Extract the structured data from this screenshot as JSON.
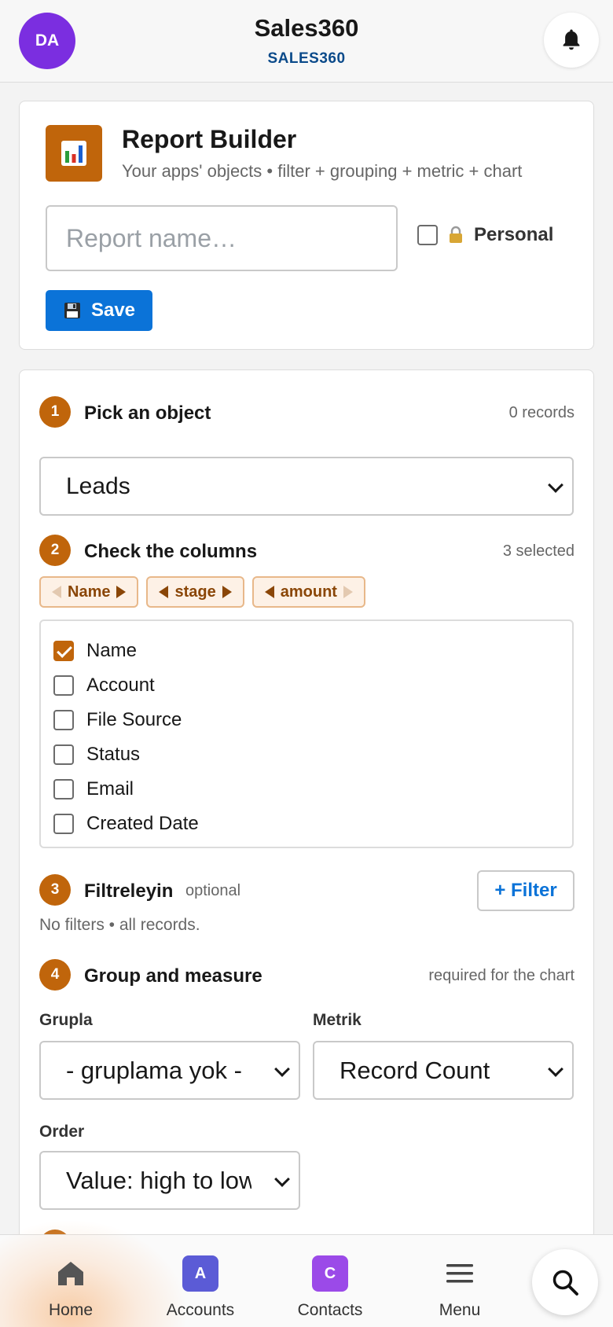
{
  "header": {
    "avatar_initials": "DA",
    "title": "Sales360",
    "subtitle": "SALES360"
  },
  "report": {
    "title": "Report Builder",
    "subtitle": "Your apps' objects • filter + grouping + metric + chart",
    "name_placeholder": "Report name…",
    "name_value": "",
    "personal_label": "Personal",
    "personal_checked": false,
    "save_label": "Save"
  },
  "step1": {
    "number": "1",
    "title": "Pick an object",
    "meta": "0 records",
    "selected_object": "Leads"
  },
  "step2": {
    "number": "2",
    "title": "Check the columns",
    "meta": "3 selected",
    "chips": [
      "Name",
      "stage",
      "amount"
    ],
    "columns": [
      {
        "label": "Name",
        "checked": true
      },
      {
        "label": "Account",
        "checked": false
      },
      {
        "label": "File Source",
        "checked": false
      },
      {
        "label": "Status",
        "checked": false
      },
      {
        "label": "Email",
        "checked": false
      },
      {
        "label": "Created Date",
        "checked": false
      }
    ]
  },
  "step3": {
    "number": "3",
    "title": "Filtreleyin",
    "meta": "optional",
    "add_filter_label": "+ Filter",
    "empty_text": "No filters • all records."
  },
  "step4": {
    "number": "4",
    "title": "Group and measure",
    "meta": "required for the chart",
    "group_label": "Grupla",
    "group_value": "- gruplama yok -",
    "metric_label": "Metrik",
    "metric_value": "Record Count",
    "order_label": "Order",
    "order_value": "Value: high to low"
  },
  "bottom_nav": {
    "items": [
      {
        "label": "Home",
        "icon": "home-icon"
      },
      {
        "label": "Accounts",
        "icon": "accounts-badge",
        "badge": "A"
      },
      {
        "label": "Contacts",
        "icon": "contacts-badge",
        "badge": "C"
      },
      {
        "label": "Menu",
        "icon": "menu-icon"
      }
    ],
    "search_icon": "search-icon"
  },
  "colors": {
    "brand_orange": "#c0650b",
    "primary_blue": "#0b73d8",
    "avatar_purple": "#7b2ee0",
    "accounts_badge": "#5b5bd6",
    "contacts_badge": "#9b4ae8"
  }
}
